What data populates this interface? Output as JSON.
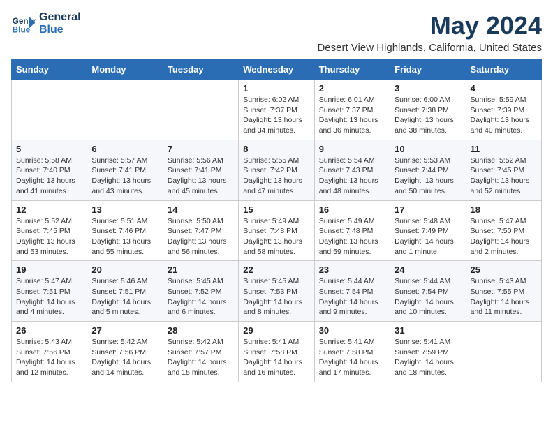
{
  "logo": {
    "line1": "General",
    "line2": "Blue"
  },
  "title": "May 2024",
  "location": "Desert View Highlands, California, United States",
  "days_of_week": [
    "Sunday",
    "Monday",
    "Tuesday",
    "Wednesday",
    "Thursday",
    "Friday",
    "Saturday"
  ],
  "weeks": [
    [
      {
        "day": "",
        "info": ""
      },
      {
        "day": "",
        "info": ""
      },
      {
        "day": "",
        "info": ""
      },
      {
        "day": "1",
        "info": "Sunrise: 6:02 AM\nSunset: 7:37 PM\nDaylight: 13 hours\nand 34 minutes."
      },
      {
        "day": "2",
        "info": "Sunrise: 6:01 AM\nSunset: 7:37 PM\nDaylight: 13 hours\nand 36 minutes."
      },
      {
        "day": "3",
        "info": "Sunrise: 6:00 AM\nSunset: 7:38 PM\nDaylight: 13 hours\nand 38 minutes."
      },
      {
        "day": "4",
        "info": "Sunrise: 5:59 AM\nSunset: 7:39 PM\nDaylight: 13 hours\nand 40 minutes."
      }
    ],
    [
      {
        "day": "5",
        "info": "Sunrise: 5:58 AM\nSunset: 7:40 PM\nDaylight: 13 hours\nand 41 minutes."
      },
      {
        "day": "6",
        "info": "Sunrise: 5:57 AM\nSunset: 7:41 PM\nDaylight: 13 hours\nand 43 minutes."
      },
      {
        "day": "7",
        "info": "Sunrise: 5:56 AM\nSunset: 7:41 PM\nDaylight: 13 hours\nand 45 minutes."
      },
      {
        "day": "8",
        "info": "Sunrise: 5:55 AM\nSunset: 7:42 PM\nDaylight: 13 hours\nand 47 minutes."
      },
      {
        "day": "9",
        "info": "Sunrise: 5:54 AM\nSunset: 7:43 PM\nDaylight: 13 hours\nand 48 minutes."
      },
      {
        "day": "10",
        "info": "Sunrise: 5:53 AM\nSunset: 7:44 PM\nDaylight: 13 hours\nand 50 minutes."
      },
      {
        "day": "11",
        "info": "Sunrise: 5:52 AM\nSunset: 7:45 PM\nDaylight: 13 hours\nand 52 minutes."
      }
    ],
    [
      {
        "day": "12",
        "info": "Sunrise: 5:52 AM\nSunset: 7:45 PM\nDaylight: 13 hours\nand 53 minutes."
      },
      {
        "day": "13",
        "info": "Sunrise: 5:51 AM\nSunset: 7:46 PM\nDaylight: 13 hours\nand 55 minutes."
      },
      {
        "day": "14",
        "info": "Sunrise: 5:50 AM\nSunset: 7:47 PM\nDaylight: 13 hours\nand 56 minutes."
      },
      {
        "day": "15",
        "info": "Sunrise: 5:49 AM\nSunset: 7:48 PM\nDaylight: 13 hours\nand 58 minutes."
      },
      {
        "day": "16",
        "info": "Sunrise: 5:49 AM\nSunset: 7:48 PM\nDaylight: 13 hours\nand 59 minutes."
      },
      {
        "day": "17",
        "info": "Sunrise: 5:48 AM\nSunset: 7:49 PM\nDaylight: 14 hours\nand 1 minute."
      },
      {
        "day": "18",
        "info": "Sunrise: 5:47 AM\nSunset: 7:50 PM\nDaylight: 14 hours\nand 2 minutes."
      }
    ],
    [
      {
        "day": "19",
        "info": "Sunrise: 5:47 AM\nSunset: 7:51 PM\nDaylight: 14 hours\nand 4 minutes."
      },
      {
        "day": "20",
        "info": "Sunrise: 5:46 AM\nSunset: 7:51 PM\nDaylight: 14 hours\nand 5 minutes."
      },
      {
        "day": "21",
        "info": "Sunrise: 5:45 AM\nSunset: 7:52 PM\nDaylight: 14 hours\nand 6 minutes."
      },
      {
        "day": "22",
        "info": "Sunrise: 5:45 AM\nSunset: 7:53 PM\nDaylight: 14 hours\nand 8 minutes."
      },
      {
        "day": "23",
        "info": "Sunrise: 5:44 AM\nSunset: 7:54 PM\nDaylight: 14 hours\nand 9 minutes."
      },
      {
        "day": "24",
        "info": "Sunrise: 5:44 AM\nSunset: 7:54 PM\nDaylight: 14 hours\nand 10 minutes."
      },
      {
        "day": "25",
        "info": "Sunrise: 5:43 AM\nSunset: 7:55 PM\nDaylight: 14 hours\nand 11 minutes."
      }
    ],
    [
      {
        "day": "26",
        "info": "Sunrise: 5:43 AM\nSunset: 7:56 PM\nDaylight: 14 hours\nand 12 minutes."
      },
      {
        "day": "27",
        "info": "Sunrise: 5:42 AM\nSunset: 7:56 PM\nDaylight: 14 hours\nand 14 minutes."
      },
      {
        "day": "28",
        "info": "Sunrise: 5:42 AM\nSunset: 7:57 PM\nDaylight: 14 hours\nand 15 minutes."
      },
      {
        "day": "29",
        "info": "Sunrise: 5:41 AM\nSunset: 7:58 PM\nDaylight: 14 hours\nand 16 minutes."
      },
      {
        "day": "30",
        "info": "Sunrise: 5:41 AM\nSunset: 7:58 PM\nDaylight: 14 hours\nand 17 minutes."
      },
      {
        "day": "31",
        "info": "Sunrise: 5:41 AM\nSunset: 7:59 PM\nDaylight: 14 hours\nand 18 minutes."
      },
      {
        "day": "",
        "info": ""
      }
    ]
  ]
}
